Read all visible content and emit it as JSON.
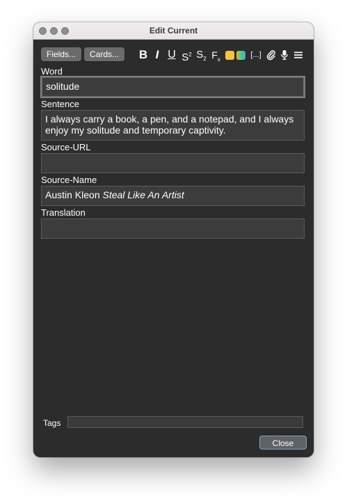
{
  "window": {
    "title": "Edit Current"
  },
  "toolbar": {
    "fields_label": "Fields...",
    "cards_label": "Cards...",
    "bold": "B",
    "italic": "I",
    "underline": "U",
    "superscript_base": "S",
    "superscript_mark": "2",
    "subscript_base": "S",
    "subscript_mark": "2",
    "clear_format_base": "F",
    "clear_format_mark": "x",
    "cloze": "[...]",
    "text_color": "#f6c343",
    "highlight_gradient": [
      "#f0a93a",
      "#4ad07a",
      "#4aa3e8"
    ]
  },
  "fields": [
    {
      "label": "Word",
      "value": "solitude"
    },
    {
      "label": "Sentence",
      "value": "I always carry a book, a pen, and a notepad, and I always enjoy my solitude and temporary captivity."
    },
    {
      "label": "Source-URL",
      "value": ""
    },
    {
      "label": "Source-Name",
      "value_plain": "Austin Kleon ",
      "value_italic": "Steal Like An Artist"
    },
    {
      "label": "Translation",
      "value": ""
    }
  ],
  "tags": {
    "label": "Tags",
    "value": ""
  },
  "footer": {
    "close_label": "Close"
  }
}
